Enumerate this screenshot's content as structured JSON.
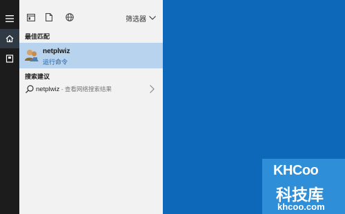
{
  "rail": {
    "icons": [
      "hamburger-menu-icon",
      "home-icon",
      "contacts-icon"
    ]
  },
  "toolbar": {
    "icons": [
      "apps-icon",
      "document-icon",
      "web-icon"
    ],
    "filter_label": "筛选器"
  },
  "best_match": {
    "section_label": "最佳匹配",
    "title": "netplwiz",
    "subtitle": "运行命令",
    "icon": "users-icon"
  },
  "suggestions": {
    "section_label": "搜索建议",
    "item_term": "netplwiz",
    "item_hint": " - 查看网络搜索结果"
  },
  "watermark": {
    "logo": "KHCoo",
    "chinese": "科技库",
    "url": "khcoo.com"
  },
  "colors": {
    "desktop": "#0d68b9",
    "rail": "#1c1c1c",
    "panel": "#f2f2f2",
    "highlight": "#b7d3ed",
    "accent_text": "#1a5fa8"
  }
}
